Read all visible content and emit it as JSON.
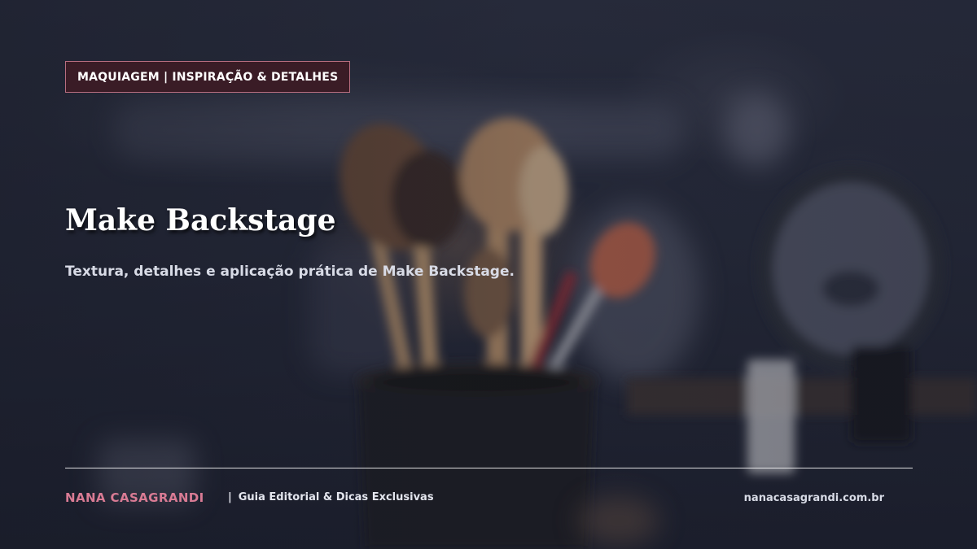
{
  "header": {
    "category_tag": "MAQUIAGEM | INSPIRAÇÃO & DETALHES"
  },
  "hero": {
    "title": "Make Backstage",
    "subtitle": "Textura, detalhes e aplicação prática de Make Backstage."
  },
  "footer": {
    "brand": "NANA CASAGRANDI",
    "separator": "|",
    "tagline": "Guia Editorial & Dicas Exclusivas",
    "website": "nanacasagrandi.com.br"
  },
  "colors": {
    "background": "#1f2231",
    "tag_fill": "#3a1c26",
    "tag_border": "#b86e80",
    "brand_accent": "#d97b94"
  }
}
